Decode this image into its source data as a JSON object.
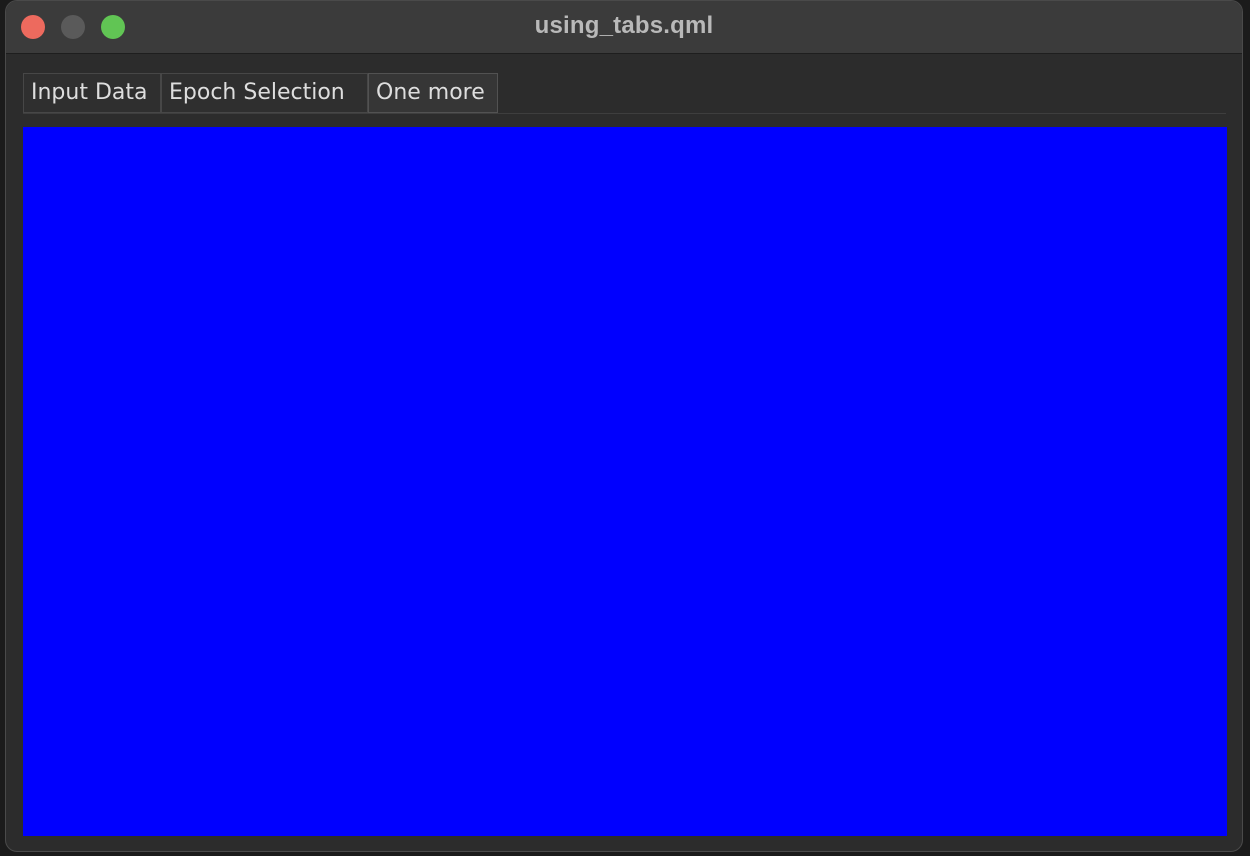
{
  "window": {
    "title": "using_tabs.qml"
  },
  "tabs": [
    {
      "label": "Input Data"
    },
    {
      "label": "Epoch Selection"
    },
    {
      "label": "One more",
      "selected": true
    }
  ],
  "content": {
    "color": "#0000ff"
  }
}
